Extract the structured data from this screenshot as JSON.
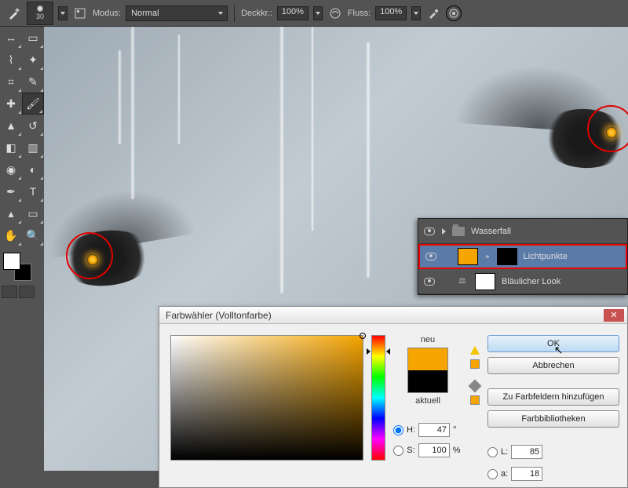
{
  "optionsBar": {
    "brushSize": "30",
    "modeLabel": "Modus:",
    "modeValue": "Normal",
    "opacityLabel": "Deckkr.:",
    "opacityValue": "100%",
    "flowLabel": "Fluss:",
    "flowValue": "100%"
  },
  "layers": {
    "rows": [
      {
        "name": "Wasserfall"
      },
      {
        "name": "Lichtpunkte"
      },
      {
        "name": "Bläulicher Look"
      }
    ]
  },
  "dialog": {
    "title": "Farbwähler (Volltonfarbe)",
    "newLabel": "neu",
    "currentLabel": "aktuell",
    "ok": "OK",
    "cancel": "Abbrechen",
    "addSwatch": "Zu Farbfeldern hinzufügen",
    "libraries": "Farbbibliotheken",
    "fields": {
      "H": {
        "label": "H:",
        "value": "47",
        "unit": "°"
      },
      "S": {
        "label": "S:",
        "value": "100",
        "unit": "%"
      },
      "L": {
        "label": "L:",
        "value": "85"
      },
      "a": {
        "label": "a:",
        "value": "18"
      }
    }
  },
  "colors": {
    "picked": "#f5a400"
  }
}
